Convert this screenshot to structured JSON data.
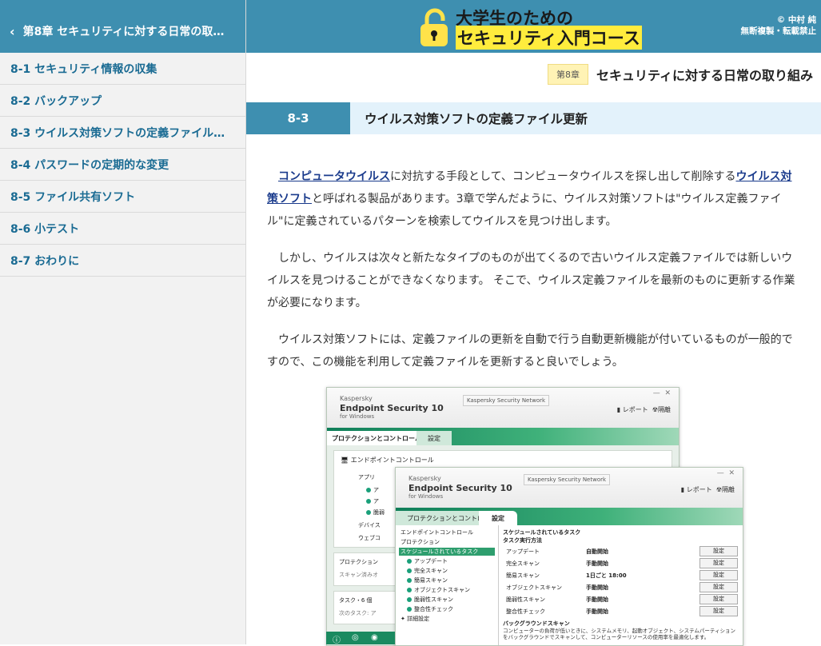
{
  "sidebar": {
    "back_label": "第8章 セキュリティに対する日常の取…",
    "items": [
      {
        "label": "8-1 セキュリティ情報の収集"
      },
      {
        "label": "8-2 バックアップ"
      },
      {
        "label": "8-3 ウイルス対策ソフトの定義ファイル…"
      },
      {
        "label": "8-4 パスワードの定期的な変更"
      },
      {
        "label": "8-5 ファイル共有ソフト"
      },
      {
        "label": "8-6 小テスト"
      },
      {
        "label": "8-7 おわりに"
      }
    ]
  },
  "header": {
    "logo_line1": "大学生のための",
    "logo_line2": "セキュリティ入門コース",
    "copyright_line1": "© 中村 純",
    "copyright_line2": "無断複製・転載禁止"
  },
  "chapter": {
    "badge": "第8章",
    "title": "セキュリティに対する日常の取り組み"
  },
  "section": {
    "number": "8-3",
    "title": "ウイルス対策ソフトの定義ファイル更新"
  },
  "body": {
    "p1_link1": "コンピュータウイルス",
    "p1_text1": "に対抗する手段として、コンピュータウイルスを探し出して削除する",
    "p1_link2": "ウイルス対策ソフト",
    "p1_text2": "と呼ばれる製品があります。3章で学んだように、ウイルス対策ソフトは\"ウイルス定義ファイル\"に定義されているパターンを検索してウイルスを見つけ出します。",
    "p2": "しかし、ウイルスは次々と新たなタイプのものが出てくるので古いウイルス定義ファイルでは新しいウイルスを見つけることができなくなります。 そこで、ウイルス定義ファイルを最新のものに更新する作業が必要になります。",
    "p3": "ウイルス対策ソフトには、定義ファイルの更新を自動で行う自動更新機能が付いているものが一般的ですので、この機能を利用して定義ファイルを更新すると良いでしょう。"
  },
  "screenshot": {
    "brand_small": "Kaspersky",
    "brand_main": "Endpoint Security 10",
    "brand_sub": "for Windows",
    "ksn": "Kaspersky Security Network",
    "report": "レポート",
    "quarantine": "隔離",
    "minimize": "—",
    "close": "✕",
    "tab_protection": "プロテクションとコントロール",
    "tab_settings": "設定",
    "back_panel_title": "エンドポイントコントロール",
    "back_items": [
      "アプリ",
      "ア",
      "ア",
      "脆弱",
      "デバイス",
      "ウェブコ"
    ],
    "back_panel2": "プロテクション",
    "back_panel2_sub": "スキャン済みオ",
    "back_panel3": "タスク・6 個",
    "back_panel3_sub": "次のタスク: ア",
    "tree": [
      "エンドポイントコントロール",
      "プロテクション",
      "スケジュールされているタスク",
      "アップデート",
      "完全スキャン",
      "簡易スキャン",
      "オブジェクトスキャン",
      "脆弱性スキャン",
      "整合性チェック",
      "詳細設定"
    ],
    "sched_title": "スケジュールされているタスク",
    "sched_sub": "タスク実行方法",
    "sched_rows": [
      {
        "task": "アップデート",
        "mode": "自動開始",
        "btn": "設定"
      },
      {
        "task": "完全スキャン",
        "mode": "手動開始",
        "btn": "設定"
      },
      {
        "task": "簡易スキャン",
        "mode": "1日ごと 18:00",
        "btn": "設定"
      },
      {
        "task": "オブジェクトスキャン",
        "mode": "手動開始",
        "btn": "設定"
      },
      {
        "task": "脆弱性スキャン",
        "mode": "手動開始",
        "btn": "設定"
      },
      {
        "task": "整合性チェック",
        "mode": "手動開始",
        "btn": "設定"
      }
    ],
    "bg_scan_title": "バックグラウンドスキャン",
    "bg_scan_text": "コンピューターの負荷が低いときに、システムメモリ、起動オブジェクト、システムパーティションをバックグラウンドでスキャンして、コンピューターリソースの使用率を最適化します。"
  },
  "colors": {
    "accent": "#3e8fb0",
    "link": "#1a6b93",
    "section_bg": "#e3f2fb",
    "highlight": "#ffec3d"
  }
}
